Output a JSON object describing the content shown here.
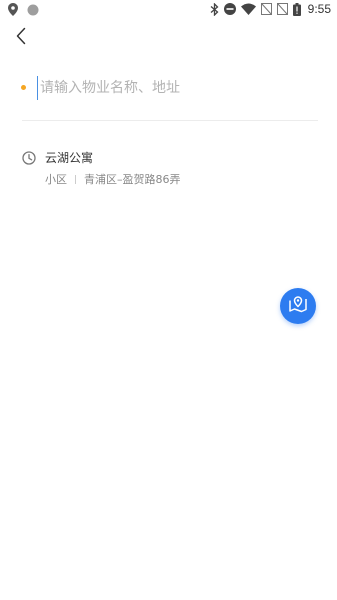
{
  "status_bar": {
    "time": "9:55",
    "left_icons": [
      "location-pin-icon",
      "circle-notification-icon"
    ],
    "right_icons": [
      "bluetooth-icon",
      "do-not-disturb-icon",
      "wifi-icon",
      "no-sim-icon",
      "no-sim-icon",
      "battery-icon"
    ]
  },
  "nav": {
    "back_icon": "chevron-left-icon"
  },
  "search": {
    "value": "",
    "placeholder": "请输入物业名称、地址",
    "dot_color": "#f5a623"
  },
  "history": {
    "items": [
      {
        "icon": "clock-icon",
        "title": "云湖公寓",
        "type": "小区",
        "address": "青浦区–盈贺路86弄"
      }
    ]
  },
  "fab": {
    "icon": "map-location-icon",
    "color": "#2d7cf0"
  }
}
